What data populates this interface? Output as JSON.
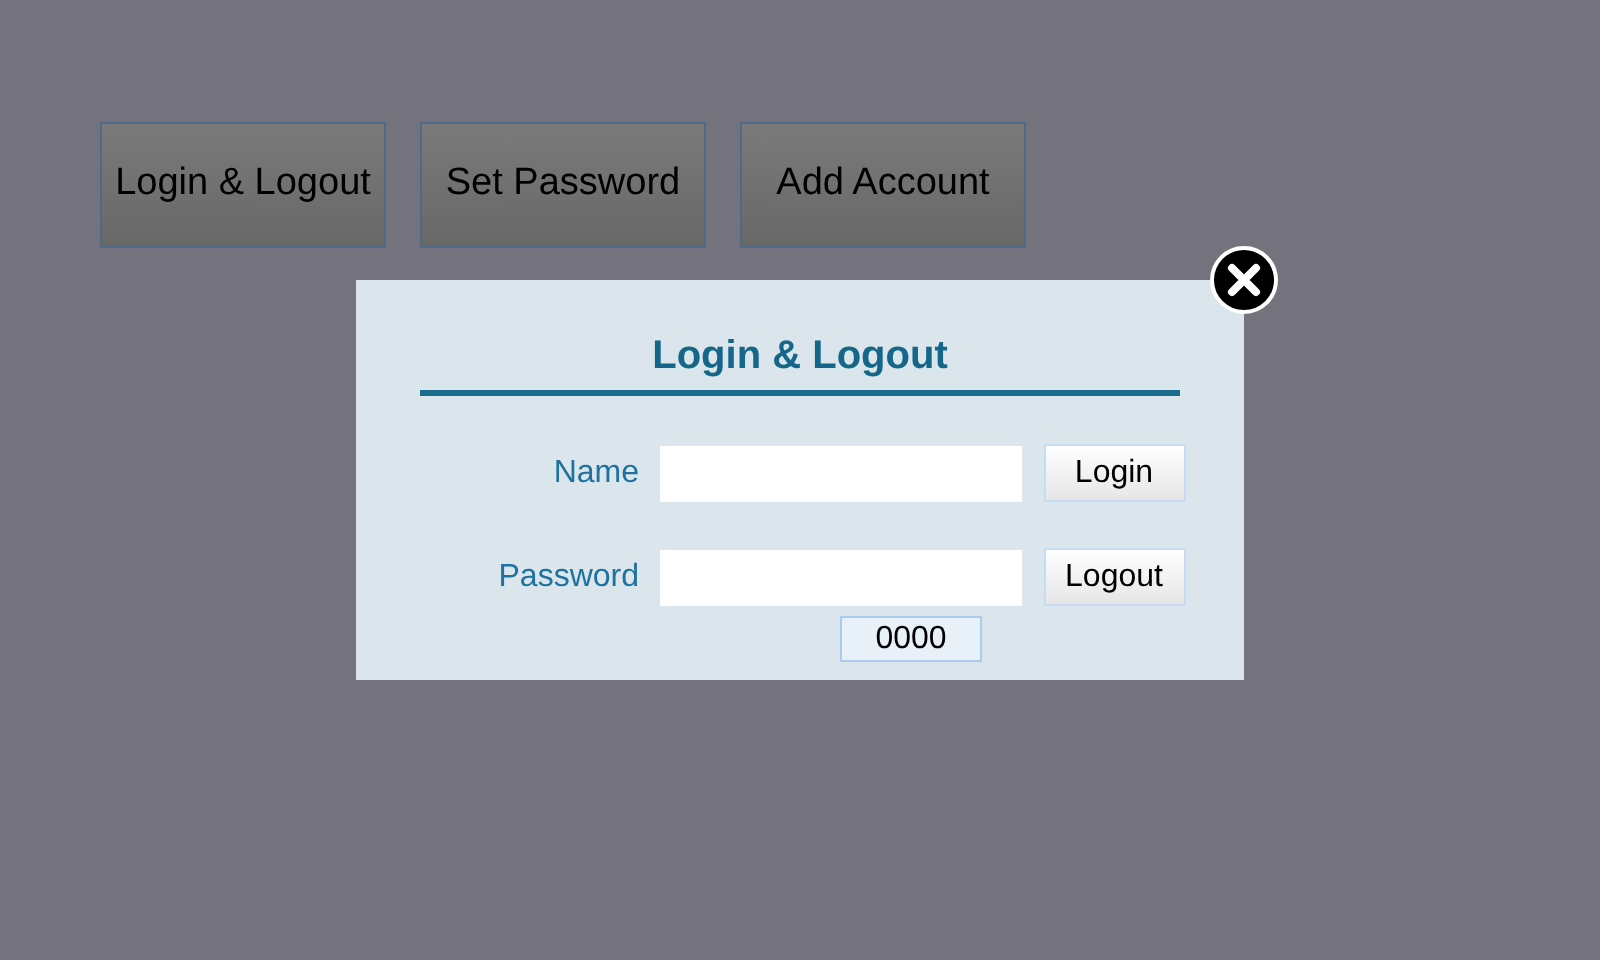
{
  "menu_buttons": [
    {
      "label": "Login & Logout"
    },
    {
      "label": "Set Password"
    },
    {
      "label": "Add Account"
    }
  ],
  "dialog": {
    "title": "Login & Logout",
    "rows": [
      {
        "label": "Name",
        "button": "Login"
      },
      {
        "label": "Password",
        "button": "Logout"
      }
    ],
    "code": "0000"
  }
}
